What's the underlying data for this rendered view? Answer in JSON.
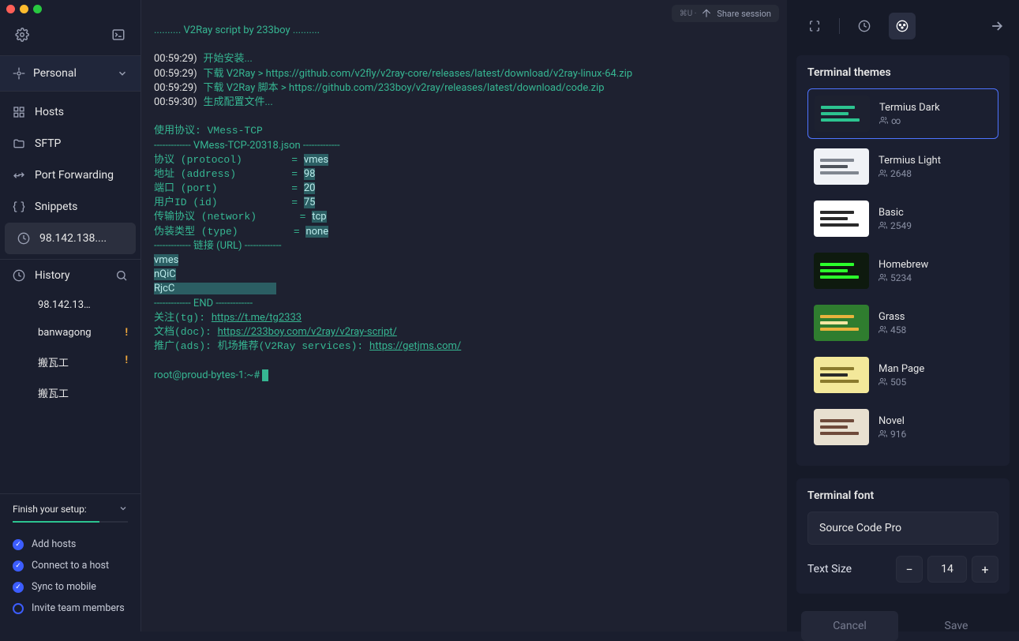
{
  "sidebar": {
    "workspace": "Personal",
    "nav": [
      {
        "icon": "grid",
        "label": "Hosts"
      },
      {
        "icon": "folder",
        "label": "SFTP"
      },
      {
        "icon": "arrows",
        "label": "Port Forwarding"
      },
      {
        "icon": "braces",
        "label": "Snippets"
      },
      {
        "icon": "clock",
        "label": "98.142.138....",
        "active": true
      }
    ],
    "history": {
      "label": "History"
    },
    "historyItems": [
      {
        "label": "98.142.13…",
        "warn": false
      },
      {
        "label": "banwagong",
        "warn": true
      },
      {
        "label": "搬瓦工",
        "warn": true
      },
      {
        "label": "搬瓦工",
        "warn": false
      }
    ],
    "setup": {
      "title": "Finish your setup:",
      "tasks": [
        {
          "done": true,
          "label": "Add hosts"
        },
        {
          "done": true,
          "label": "Connect to a host"
        },
        {
          "done": true,
          "label": "Sync to mobile"
        },
        {
          "done": false,
          "label": "Invite team members"
        }
      ]
    }
  },
  "share": {
    "label": "Share session"
  },
  "terminal": {
    "header": ".......... V2Ray script by 233boy ..........",
    "t1": "00:59:29",
    "l1": "开始安装...",
    "t2": "00:59:29",
    "l2": "下载 V2Ray > https://github.com/v2fly/v2ray-core/releases/latest/download/v2ray-linux-64.zip",
    "t3": "00:59:29",
    "l3": "下载 V2Ray 脚本 > https://github.com/233boy/v2ray/releases/latest/download/code.zip",
    "t4": "00:59:30",
    "l4": "生成配置文件...",
    "proto": "使用协议: VMess-TCP",
    "divider1": "------------- VMess-TCP-20318.json -------------",
    "kv": [
      {
        "k": "协议 (protocol) ",
        "v": "vmes"
      },
      {
        "k": "地址 (address)  ",
        "v": "98"
      },
      {
        "k": "端口 (port)     ",
        "v": "20"
      },
      {
        "k": "用户ID (id)     ",
        "v": "75"
      },
      {
        "k": "传输协议 (network)",
        "v": "tcp"
      },
      {
        "k": "伪装类型 (type)  ",
        "v": "none"
      }
    ],
    "divider2": "------------- 链接 (URL) -------------",
    "blob": [
      "vmes",
      "nQiC",
      "RjcC"
    ],
    "divider3": "------------- END -------------",
    "links": [
      {
        "pre": "关注(tg): ",
        "url": "https://t.me/tg2333"
      },
      {
        "pre": "文档(doc): ",
        "url": "https://233boy.com/v2ray/v2ray-script/"
      },
      {
        "pre": "推广(ads): 机场推荐(V2Ray services): ",
        "url": "https://getjms.com/"
      }
    ],
    "prompt": "root@proud-bytes-1:~# "
  },
  "panel": {
    "themes_title": "Terminal themes",
    "themes": [
      {
        "name": "Termius Dark",
        "info": "∞",
        "selected": true,
        "bg": "#1d2130",
        "c1": "#2cc490",
        "c2": "#2cc490",
        "c3": "#2cc490"
      },
      {
        "name": "Termius Light",
        "info": "2648",
        "selected": false,
        "bg": "#f0f2f6",
        "c1": "#808690",
        "c2": "#4f545c",
        "c3": "#808690"
      },
      {
        "name": "Basic",
        "info": "2549",
        "selected": false,
        "bg": "#ffffff",
        "c1": "#2a2a2a",
        "c2": "#2a2a2a",
        "c3": "#2a2a2a"
      },
      {
        "name": "Homebrew",
        "info": "5234",
        "selected": false,
        "bg": "#0e1a0e",
        "c1": "#2bff2b",
        "c2": "#2bff2b",
        "c3": "#2bff2b"
      },
      {
        "name": "Grass",
        "info": "458",
        "selected": false,
        "bg": "#2f7d2f",
        "c1": "#e8b33d",
        "c2": "#f5e7a2",
        "c3": "#e8b33d"
      },
      {
        "name": "Man Page",
        "info": "505",
        "selected": false,
        "bg": "#f3e89a",
        "c1": "#8a7a2d",
        "c2": "#2a2a2a",
        "c3": "#8a7a2d"
      },
      {
        "name": "Novel",
        "info": "916",
        "selected": false,
        "bg": "#e8e0d0",
        "c1": "#6f4a3a",
        "c2": "#6f4a3a",
        "c3": "#6f4a3a"
      }
    ],
    "font_title": "Terminal font",
    "font_value": "Source Code Pro",
    "size_label": "Text Size",
    "size_value": "14",
    "cancel": "Cancel",
    "save": "Save"
  }
}
